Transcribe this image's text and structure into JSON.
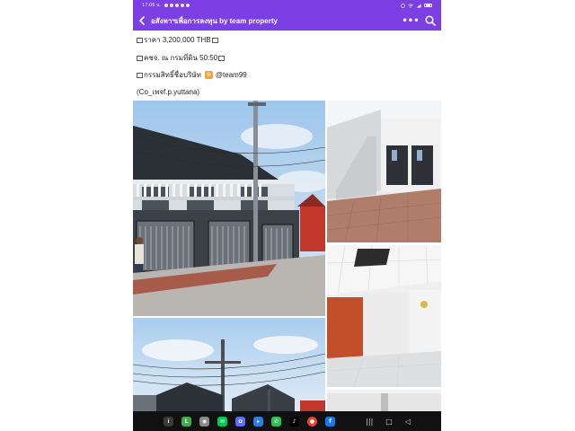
{
  "status": {
    "time": "17:06 น."
  },
  "appbar": {
    "title": "อสังหาฯเพื่อการลงทุน  by team property",
    "more_label": "•••",
    "back_icon": "chevron-left-icon",
    "search_icon": "search-icon"
  },
  "post": {
    "price": "ราคา 3,200,000 THB",
    "fees": "คชจ. ณ กรมที่ดิน 50:50",
    "ownership_label": "กรรมสิทธิ์ชื่อบริษัท",
    "ownership_handle": "@team99",
    "credit": "(Co_เพจf.p.yuttana)"
  },
  "gallery": {
    "photos": [
      {
        "name": "house-exterior-photo",
        "subject": "two-storey townhouse front with gates"
      },
      {
        "name": "interior-hall-photo",
        "subject": "interior hall with staircase"
      },
      {
        "name": "interior-room-photo",
        "subject": "white room with red door and ceiling hatch"
      },
      {
        "name": "street-powerline-photo",
        "subject": "street with power pole and rooftops"
      },
      {
        "name": "interior-partial-photo",
        "subject": "interior ceiling partial"
      }
    ]
  },
  "navbar": {
    "apps": [
      {
        "name": "launcher-app-icon",
        "color": "#3a3a3a"
      },
      {
        "name": "line-app-icon",
        "color": "#3fae4a"
      },
      {
        "name": "camera-app-icon",
        "color": "#8a8a8a"
      },
      {
        "name": "chat-app-icon",
        "color": "#06c755"
      },
      {
        "name": "gallery-app-icon",
        "color": "#5b6cff"
      },
      {
        "name": "files-app-icon",
        "color": "#2f7de1"
      },
      {
        "name": "messages-app-icon",
        "color": "#2fbf55"
      },
      {
        "name": "tiktok-app-icon",
        "color": "#000000"
      },
      {
        "name": "chrome-app-icon",
        "color": "#e94335"
      },
      {
        "name": "facebook-app-icon",
        "color": "#1877f2"
      }
    ],
    "system_buttons": [
      "recent-apps-icon",
      "home-icon",
      "back-icon"
    ]
  },
  "colors": {
    "accent": "#7b3fe4"
  }
}
